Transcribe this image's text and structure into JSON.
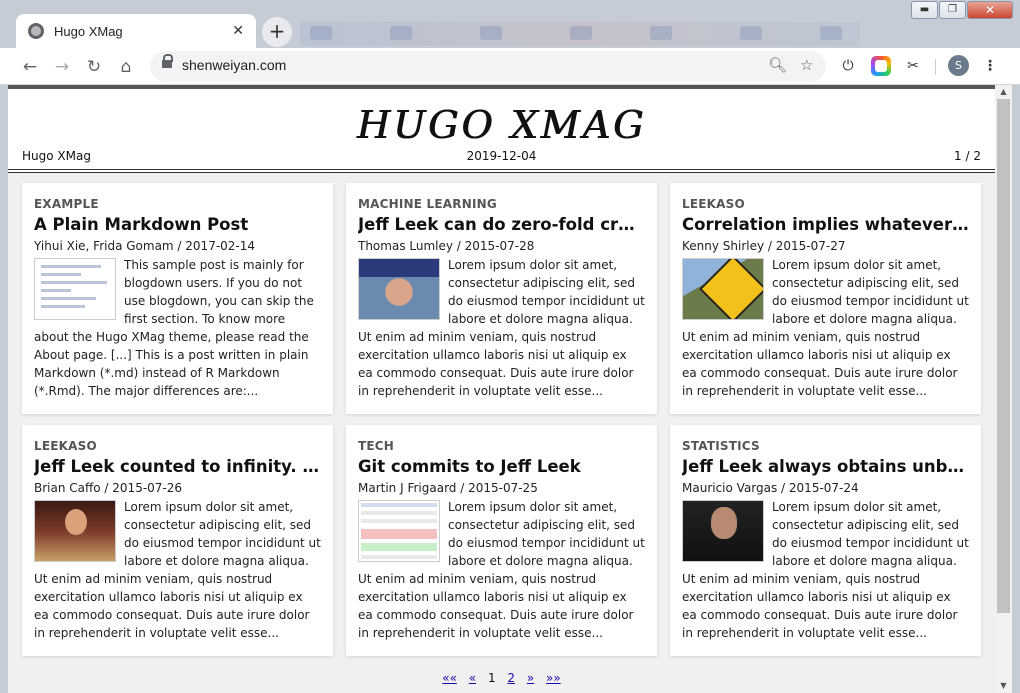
{
  "browser": {
    "tab_title": "Hugo XMag",
    "tab_close": "✕",
    "new_tab": "+",
    "url": "shenweiyan.com",
    "avatar_letter": "S",
    "window_controls": {
      "minimize": "▬",
      "maximize": "❐",
      "close": "✕"
    },
    "icons": [
      "back-icon",
      "forward-icon",
      "reload-icon",
      "home-icon",
      "lock-icon",
      "zoom-icon",
      "star-icon",
      "power-icon",
      "extension-icon",
      "scissors-icon",
      "menu-icon"
    ]
  },
  "site": {
    "logo": "HUGO XMAG",
    "name": "Hugo XMag",
    "date": "2019-12-04",
    "page_indicator": "1 / 2"
  },
  "posts": [
    {
      "category": "EXAMPLE",
      "title": "A Plain Markdown Post",
      "byline": "Yihui Xie, Frida Gomam / 2017-02-14",
      "excerpt": "This sample post is mainly for blogdown users. If you do not use blogdown, you can skip the first section. To know more about the Hugo XMag theme, please read the About page. [...] This is a post written in plain Markdown (*.md) instead of R Markdown (*.Rmd). The major differences are:..."
    },
    {
      "category": "MACHINE LEARNING",
      "title": "Jeff Leek can do zero-fold cross-validation",
      "byline": "Thomas Lumley / 2015-07-28",
      "excerpt": "Lorem ipsum dolor sit amet, consectetur adipiscing elit, sed do eiusmod tempor incididunt ut labore et dolore magna aliqua. Ut enim ad minim veniam, quis nostrud exercitation ullamco laboris nisi ut aliquip ex ea commodo consequat. Duis aute irure dolor in reprehenderit in voluptate velit esse..."
    },
    {
      "category": "LEEKASO",
      "title": "Correlation implies whatever Jeff Leek wants",
      "byline": "Kenny Shirley / 2015-07-27",
      "excerpt": "Lorem ipsum dolor sit amet, consectetur adipiscing elit, sed do eiusmod tempor incididunt ut labore et dolore magna aliqua. Ut enim ad minim veniam, quis nostrud exercitation ullamco laboris nisi ut aliquip ex ea commodo consequat. Duis aute irure dolor in reprehenderit in voluptate velit esse..."
    },
    {
      "category": "LEEKASO",
      "title": "Jeff Leek counted to infinity. Twice.",
      "byline": "Brian Caffo / 2015-07-26",
      "excerpt": "Lorem ipsum dolor sit amet, consectetur adipiscing elit, sed do eiusmod tempor incididunt ut labore et dolore magna aliqua. Ut enim ad minim veniam, quis nostrud exercitation ullamco laboris nisi ut aliquip ex ea commodo consequat. Duis aute irure dolor in reprehenderit in voluptate velit esse..."
    },
    {
      "category": "TECH",
      "title": "Git commits to Jeff Leek",
      "byline": "Martin J Frigaard / 2015-07-25",
      "excerpt": "Lorem ipsum dolor sit amet, consectetur adipiscing elit, sed do eiusmod tempor incididunt ut labore et dolore magna aliqua. Ut enim ad minim veniam, quis nostrud exercitation ullamco laboris nisi ut aliquip ex ea commodo consequat. Duis aute irure dolor in reprehenderit in voluptate velit esse..."
    },
    {
      "category": "STATISTICS",
      "title": "Jeff Leek always obtains unbiased estimates",
      "byline": "Mauricio Vargas / 2015-07-24",
      "excerpt": "Lorem ipsum dolor sit amet, consectetur adipiscing elit, sed do eiusmod tempor incididunt ut labore et dolore magna aliqua. Ut enim ad minim veniam, quis nostrud exercitation ullamco laboris nisi ut aliquip ex ea commodo consequat. Duis aute irure dolor in reprehenderit in voluptate velit esse..."
    }
  ],
  "pagination": {
    "first": "««",
    "prev": "«",
    "current": "1",
    "next_page": "2",
    "next": "»",
    "last": "»»"
  },
  "colors": {
    "link": "#1a0dab",
    "grid_bg": "#f0f0f0",
    "chrome": "#c6ccd6"
  }
}
